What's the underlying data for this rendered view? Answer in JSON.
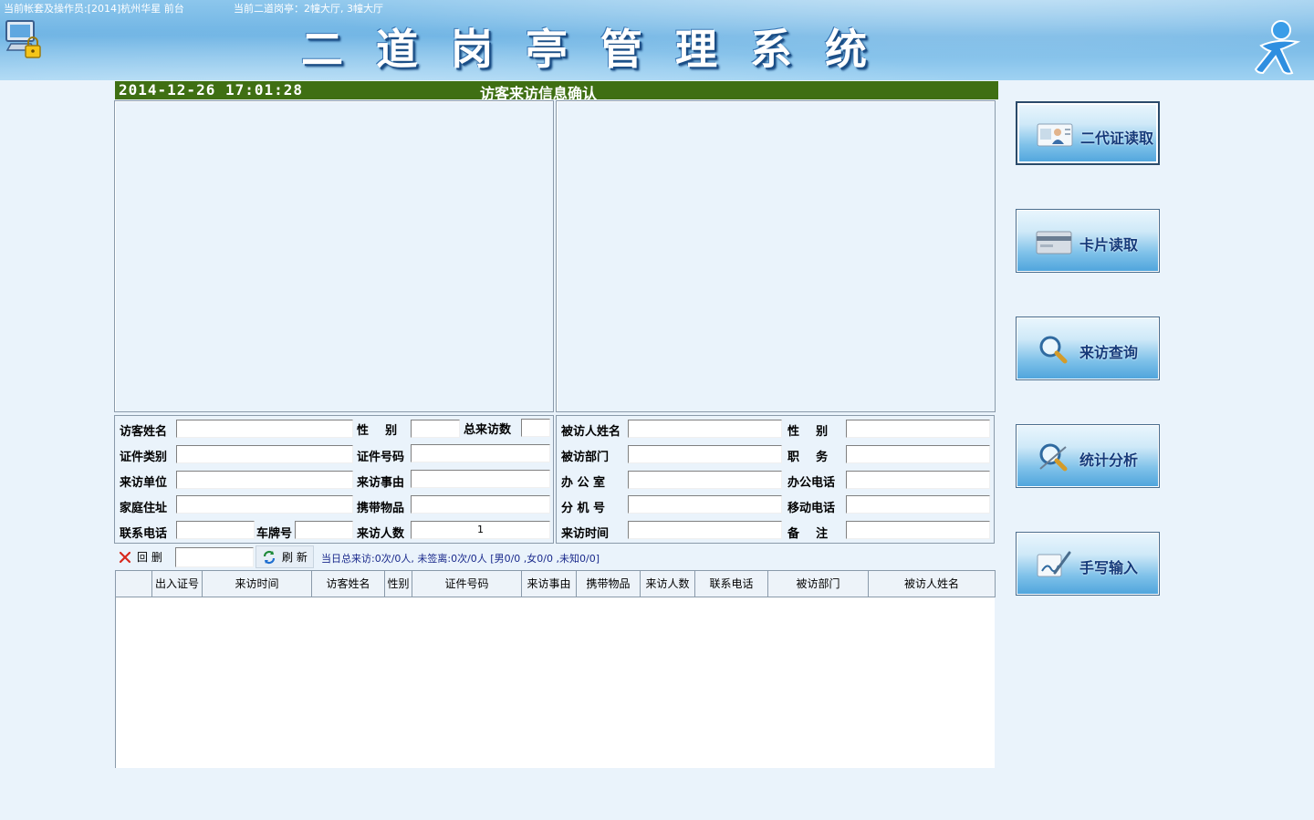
{
  "header": {
    "operator_info": "当前帐套及操作员:[2014]杭州华星    前台",
    "post_info": "当前二道岗亭：2幢大厅, 3幢大厅",
    "system_title": "二道岗亭管理系统"
  },
  "title_bar": {
    "datetime": "2014-12-26 17:01:28",
    "caption": "访客来访信息确认"
  },
  "visitor_form": {
    "name_label": "访客姓名",
    "gender_label": "性    别",
    "total_visits_label": "总来访数",
    "id_type_label": "证件类别",
    "id_number_label": "证件号码",
    "org_label": "来访单位",
    "reason_label": "来访事由",
    "address_label": "家庭住址",
    "items_label": "携带物品",
    "phone_label": "联系电话",
    "plate_label": "车牌号",
    "count_label": "来访人数",
    "count_value": "1"
  },
  "host_form": {
    "name_label": "被访人姓名",
    "gender_label": "性    别",
    "dept_label": "被访部门",
    "title_label": "职    务",
    "office_label": "办 公 室",
    "office_phone_label": "办公电话",
    "ext_label": "分 机 号",
    "mobile_label": "移动电话",
    "time_label": "来访时间",
    "remark_label": "备    注"
  },
  "toolbar": {
    "delete_label": "回 删",
    "refresh_label": "刷 新",
    "status": "当日总来访:0次/0人,  未签离:0次/0人 [男0/0 ,女0/0 ,未知0/0]"
  },
  "table": {
    "columns": [
      "",
      "出入证号",
      "来访时间",
      "访客姓名",
      "性别",
      "证件号码",
      "来访事由",
      "携带物品",
      "来访人数",
      "联系电话",
      "被访部门",
      "被访人姓名"
    ]
  },
  "side_buttons": [
    {
      "label": "二代证读取",
      "icon": "id-card-icon"
    },
    {
      "label": "卡片读取",
      "icon": "card-icon"
    },
    {
      "label": "来访查询",
      "icon": "magnifier-icon"
    },
    {
      "label": "统计分析",
      "icon": "analysis-icon"
    },
    {
      "label": "手写输入",
      "icon": "handwriting-icon"
    }
  ],
  "colors": {
    "title_bar": "#3f6f13",
    "header": "#6fb4e4",
    "status_text": "#1a2a8c",
    "button_text": "#153a7a"
  }
}
